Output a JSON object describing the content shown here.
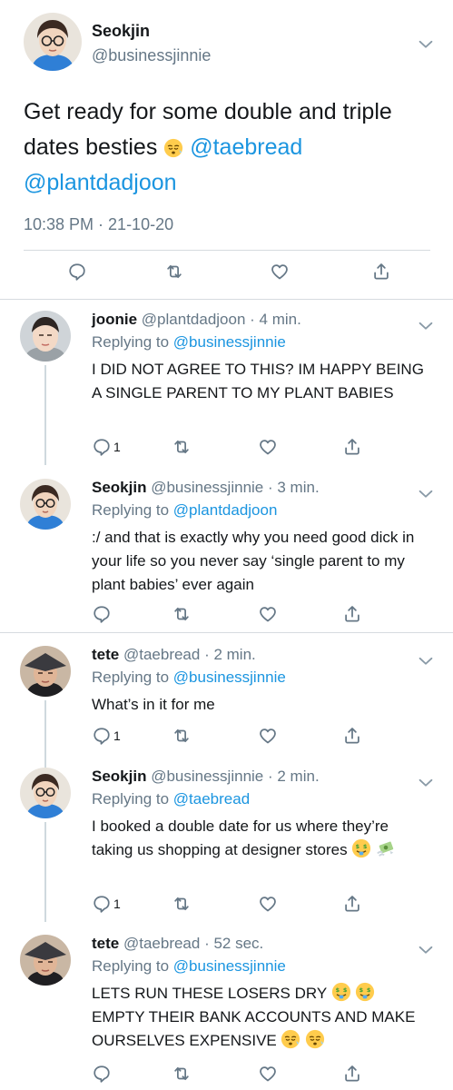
{
  "colors": {
    "link": "#1b95e0",
    "secondary": "#657786",
    "divider": "#d6dbdf"
  },
  "main": {
    "name": "Seokjin",
    "handle": "@businessjinnie",
    "text_before": "Get ready for some double and triple dates besties ",
    "emoji": "worried-face-emoji",
    "mention_1": "@taebread",
    "mention_2": "@plantdadjoon",
    "timestamp": "10:38 PM · 21-10-20",
    "icons": [
      "reply-icon",
      "retweet-icon",
      "like-icon",
      "share-icon"
    ]
  },
  "replies": [
    {
      "name": "joonie",
      "handle": "@plantdadjoon",
      "time": "· 4 min.",
      "replying_label": "Replying to",
      "replying_to": "@businessjinnie",
      "text": "I DID NOT AGREE TO THIS? IM HAPPY BEING A SINGLE PARENT TO MY PLANT BABIES",
      "reply_count": "1"
    },
    {
      "name": "Seokjin",
      "handle": "@businessjinnie",
      "time": "· 3 min.",
      "replying_label": "Replying to",
      "replying_to": "@plantdadjoon",
      "text": ":/ and that is exactly why you need good dick in your life so you never say ‘single parent to my plant babies’ ever again",
      "reply_count": ""
    },
    {
      "name": "tete",
      "handle": "@taebread",
      "time": "· 2 min.",
      "replying_label": "Replying to",
      "replying_to": "@businessjinnie",
      "text": "What’s in it for me",
      "reply_count": "1"
    },
    {
      "name": "Seokjin",
      "handle": "@businessjinnie",
      "time": "· 2 min.",
      "replying_label": "Replying to",
      "replying_to": "@taebread",
      "text": "I booked a double date for us where they’re taking us shopping at designer stores ",
      "reply_count": "1"
    },
    {
      "name": "tete",
      "handle": "@taebread",
      "time": "· 52 sec.",
      "replying_label": "Replying to",
      "replying_to": "@businessjinnie",
      "text_1": "LETS RUN THESE LOSERS DRY ",
      "text_2": " EMPTY THEIR BANK ACCOUNTS AND MAKE OURSELVES EXPENSIVE ",
      "reply_count": ""
    }
  ]
}
